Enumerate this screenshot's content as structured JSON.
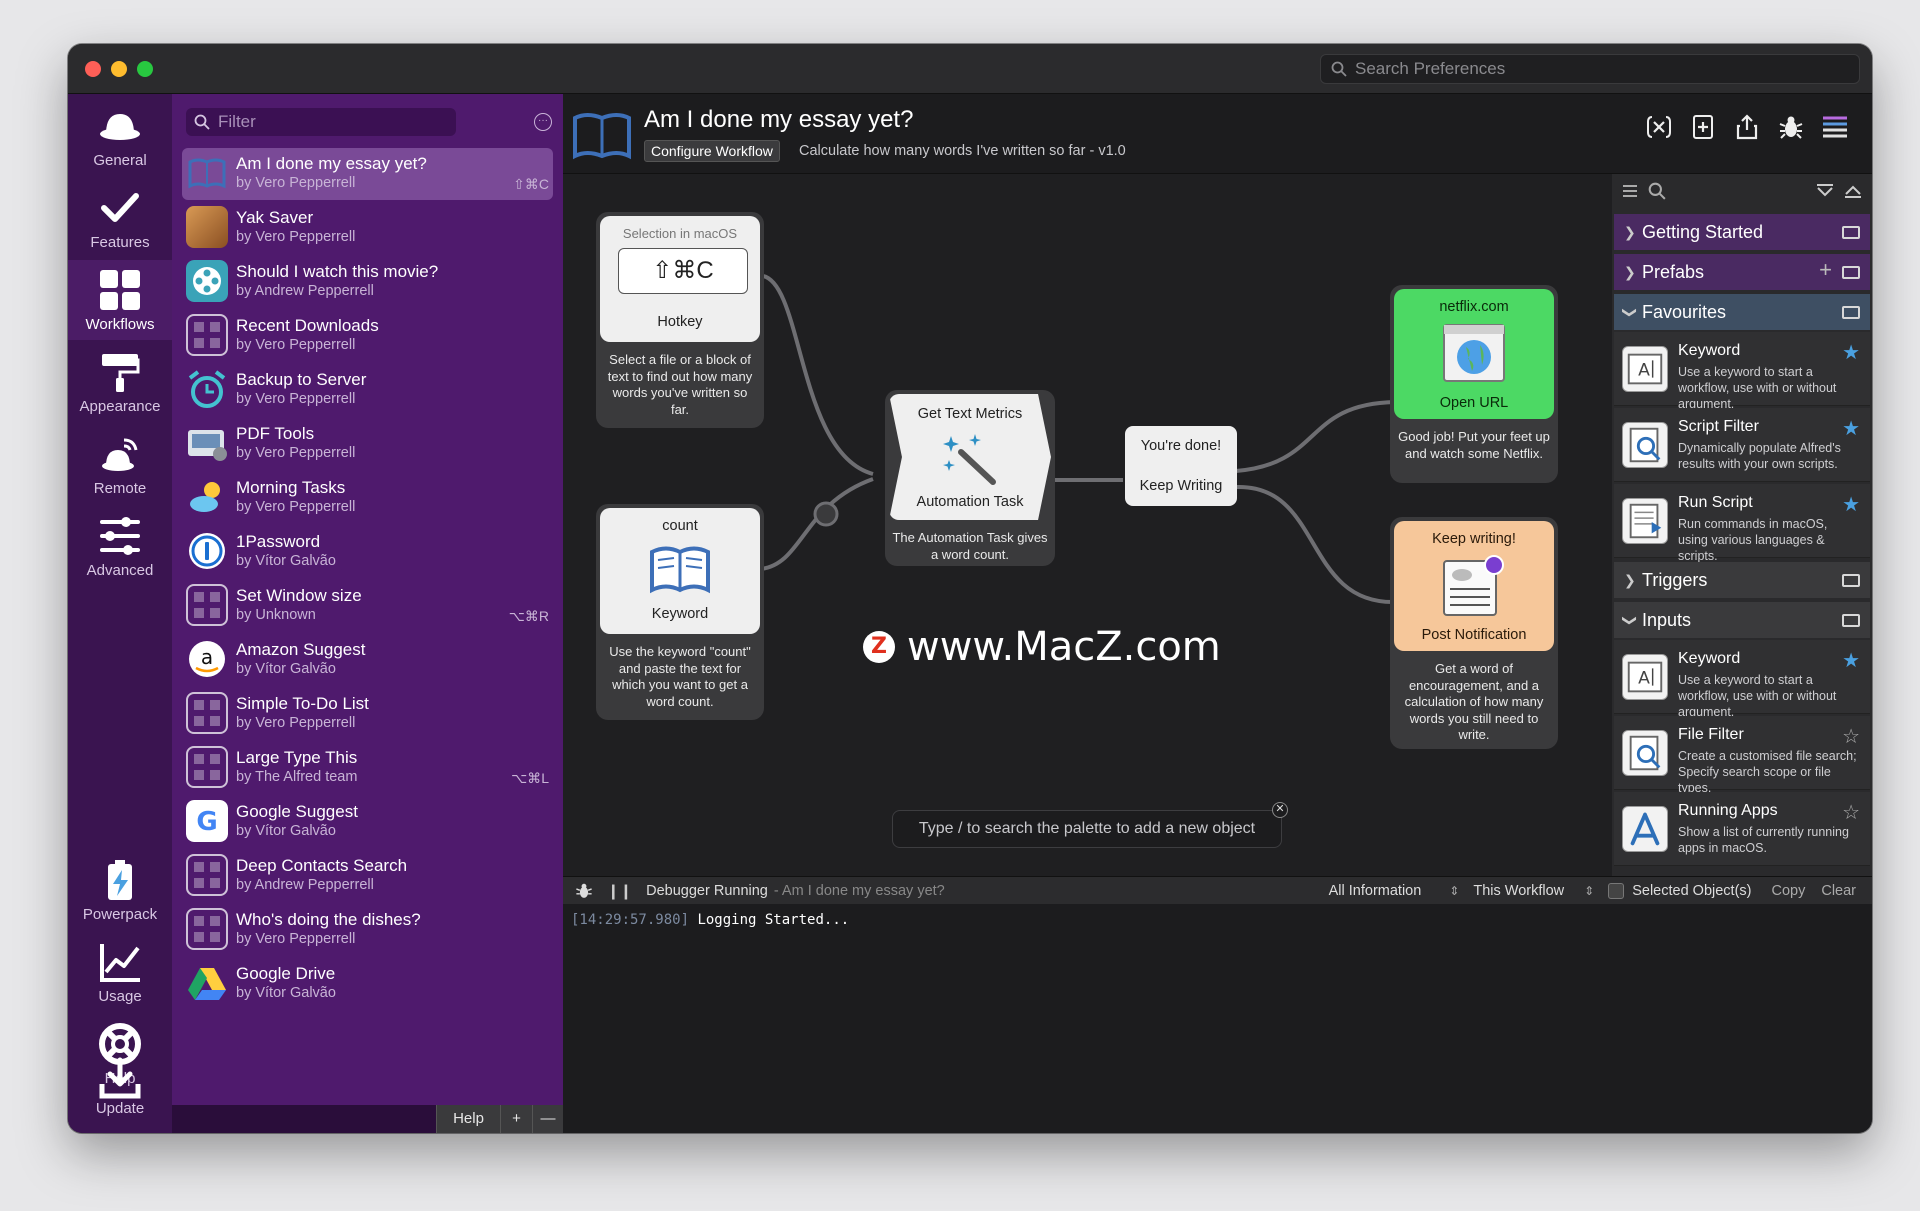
{
  "titlebar": {
    "search_placeholder": "Search Preferences"
  },
  "nav": {
    "items": [
      {
        "label": "General"
      },
      {
        "label": "Features"
      },
      {
        "label": "Workflows"
      },
      {
        "label": "Appearance"
      },
      {
        "label": "Remote"
      },
      {
        "label": "Advanced"
      },
      {
        "label": "Powerpack"
      },
      {
        "label": "Usage"
      },
      {
        "label": "Help"
      },
      {
        "label": "Update"
      }
    ]
  },
  "workflows": {
    "filter_placeholder": "Filter",
    "items": [
      {
        "name": "Am I done my essay yet?",
        "author": "by Vero Pepperrell",
        "hotkey": "⇧⌘C"
      },
      {
        "name": "Yak Saver",
        "author": "by Vero Pepperrell",
        "hotkey": ""
      },
      {
        "name": "Should I watch this movie?",
        "author": "by Andrew Pepperrell",
        "hotkey": ""
      },
      {
        "name": "Recent Downloads",
        "author": "by Vero Pepperrell",
        "hotkey": ""
      },
      {
        "name": "Backup to Server",
        "author": "by Vero Pepperrell",
        "hotkey": ""
      },
      {
        "name": "PDF Tools",
        "author": "by Vero Pepperrell",
        "hotkey": ""
      },
      {
        "name": "Morning Tasks",
        "author": "by Vero Pepperrell",
        "hotkey": ""
      },
      {
        "name": "1Password",
        "author": "by Vítor Galvão",
        "hotkey": ""
      },
      {
        "name": "Set Window size",
        "author": "by Unknown",
        "hotkey": "⌥⌘R"
      },
      {
        "name": "Amazon Suggest",
        "author": "by Vítor Galvão",
        "hotkey": ""
      },
      {
        "name": "Simple To-Do List",
        "author": "by Vero Pepperrell",
        "hotkey": ""
      },
      {
        "name": "Large Type This",
        "author": "by The Alfred team",
        "hotkey": "⌥⌘L"
      },
      {
        "name": "Google Suggest",
        "author": "by Vítor Galvão",
        "hotkey": ""
      },
      {
        "name": "Deep Contacts Search",
        "author": "by Andrew Pepperrell",
        "hotkey": ""
      },
      {
        "name": "Who's doing the dishes?",
        "author": "by Vero Pepperrell",
        "hotkey": ""
      },
      {
        "name": "Google Drive",
        "author": "by Vítor Galvão",
        "hotkey": ""
      }
    ],
    "footer": {
      "help": "Help",
      "add": "+",
      "remove": "—"
    }
  },
  "header": {
    "title": "Am I done my essay yet?",
    "configure_label": "Configure Workflow",
    "description": "Calculate how many words I've written so far - v1.0"
  },
  "canvas": {
    "hotkey_node": {
      "top": "Selection in macOS",
      "key": "⇧⌘C",
      "label": "Hotkey",
      "note": "Select a file or a block of text to find out how many words you've written so far."
    },
    "keyword_node": {
      "top": "count",
      "label": "Keyword",
      "note": "Use the keyword \"count\" and paste the text for which you want to get a word count."
    },
    "automation_node": {
      "top": "Get Text Metrics",
      "label": "Automation Task",
      "note": "The Automation Task gives a word count."
    },
    "conditional_node": {
      "done": "You're done!",
      "keep": "Keep Writing"
    },
    "openurl_node": {
      "top": "netflix.com",
      "label": "Open URL",
      "note": "Good job! Put your feet up and watch some Netflix."
    },
    "notify_node": {
      "top": "Keep writing!",
      "label": "Post Notification",
      "note": "Get a word of encouragement, and a calculation of how many words you still need to write."
    },
    "watermark": "www.MacZ.com",
    "palette_hint": "Type / to search the palette to add a new object"
  },
  "palette": {
    "sections": {
      "getting_started": "Getting Started",
      "prefabs": "Prefabs",
      "favourites": "Favourites",
      "triggers": "Triggers",
      "inputs": "Inputs"
    },
    "favourites": [
      {
        "title": "Keyword",
        "desc": "Use a keyword to start a workflow, use with or without argument."
      },
      {
        "title": "Script Filter",
        "desc": "Dynamically populate Alfred's results with your own scripts."
      },
      {
        "title": "Run Script",
        "desc": "Run commands in macOS, using various languages & scripts."
      }
    ],
    "inputs": [
      {
        "title": "Keyword",
        "desc": "Use a keyword to start a workflow, use with or without argument."
      },
      {
        "title": "File Filter",
        "desc": "Create a customised file search; Specify search scope or file types."
      },
      {
        "title": "Running Apps",
        "desc": "Show a list of currently running apps in macOS."
      }
    ]
  },
  "debugger": {
    "status": "Debugger Running",
    "context": "- Am I done my essay yet?",
    "info_level": "All Information",
    "scope": "This Workflow",
    "selected": "Selected Object(s)",
    "copy": "Copy",
    "clear": "Clear",
    "log_time": "[14:29:57.980]",
    "log_msg": "Logging Started..."
  },
  "colors": {
    "nav_bg": "#3a1450",
    "list_bg": "#4f1a6d",
    "openurl_green": "#4cd964",
    "notify_orange": "#f6c79a",
    "star_blue": "#4aa0e0"
  }
}
